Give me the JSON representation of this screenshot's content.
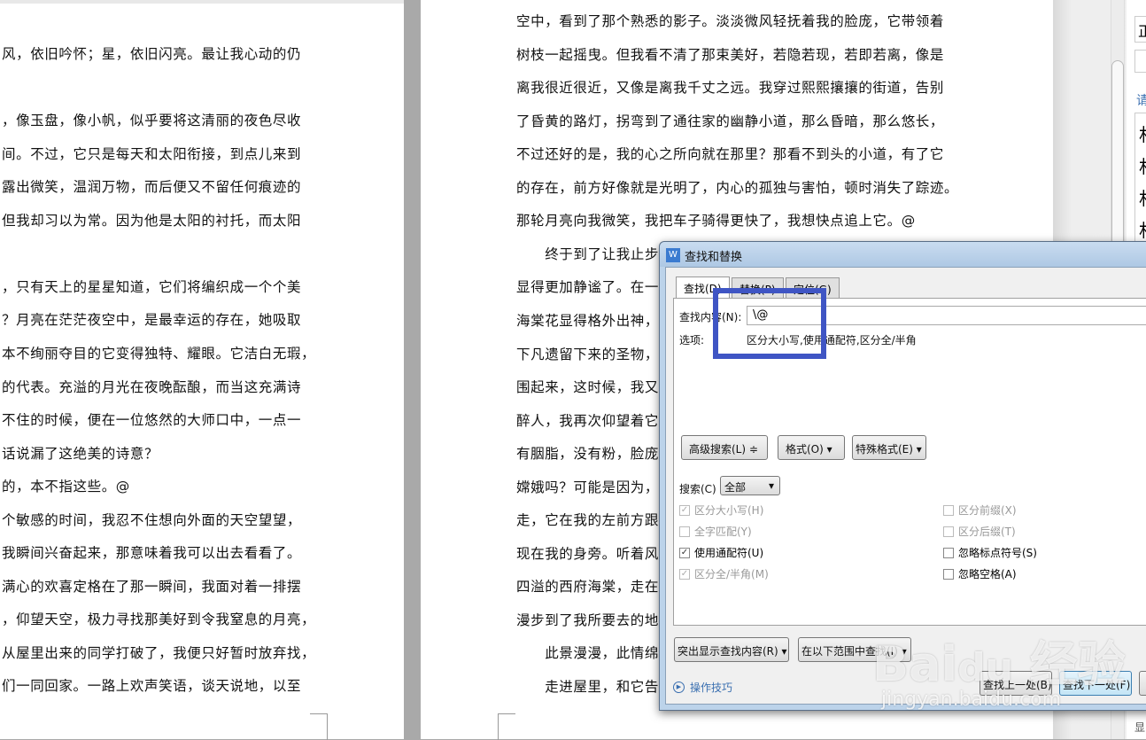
{
  "document": {
    "left_page_lines": [
      "风，依旧吟怀；星，依旧闪亮。最让我心动的仍",
      "",
      "，像玉盘，像小帆，似乎要将这清丽的夜色尽收",
      "间。不过，它只是每天和太阳衔接，到点儿来到",
      "露出微笑，温润万物，而后便又不留任何痕迹的",
      "但我却习以为常。因为他是太阳的衬托，而太阳",
      "",
      "，只有天上的星星知道，它们将编织成一个个美",
      "？月亮在茫茫夜空中，是最幸运的存在，她吸取",
      "本不绚丽夺目的它变得独特、耀眼。它洁白无瑕，",
      "的代表。充溢的月光在夜晚酝酿，而当这充满诗",
      "不住的时候，便在一位悠然的大师口中，一点一",
      "话说漏了这绝美的诗意？",
      "的，本不指这些。@",
      "个敏感的时间，我忍不住想向外面的天空望望，",
      "我瞬间兴奋起来，那意味着我可以出去看看了。",
      "满心的欢喜定格在了那一瞬间，我面对着一排摆",
      "，仰望天空，极力寻找那美好到令我窒息的月亮，",
      "从屋里出来的同学打破了，我便只好暂时放弃找，",
      "们一同回家。一路上欢声笑语，谈天说地，以至"
    ],
    "right_page_lines": [
      "空中，看到了那个熟悉的影子。淡淡微风轻抚着我的脸庞，它带领着",
      "树枝一起摇曳。但我看不清了那束美好，若隐若现，若即若离，像是",
      "离我很近很近，又像是离我千丈之远。我穿过熙熙攘攘的街道，告别",
      "了昏黄的路灯，拐弯到了通往家的幽静小道，那么昏暗，那么悠长，",
      "不过还好的是，我的心之所向就在那里？那看不到头的小道，有了它",
      "的存在，前方好像就是光明了，内心的孤独与害怕，顿时消失了踪迹。",
      "那轮月亮向我微笑，我把车子骑得更快了，我想快点追上它。@",
      "　　终于到了让我止步",
      "显得更加静谧了。在一",
      "海棠花显得格外出神，",
      "下凡遗留下来的圣物，",
      "围起来，这时候，我又",
      "醉人，我再次仰望着它",
      "有胭脂，没有粉，脸庞",
      "嫦娥吗？可能是因为，",
      "走，它在我的左前方跟",
      "现在我的身旁。听着风",
      "四溢的西府海棠，走在",
      "漫步到了我所要去的地",
      "　　此景漫漫，此情绵",
      "　　走进屋里，和它告"
    ]
  },
  "side_panel": {
    "items": [
      "正",
      "",
      "请",
      "村",
      "村",
      "村",
      "村"
    ],
    "bottom_label": "显"
  },
  "dialog": {
    "app_icon": "W",
    "title": "查找和替换",
    "tabs": [
      {
        "label": "查找(D)",
        "active": true
      },
      {
        "label": "替换(P)",
        "active": false
      },
      {
        "label": "定位(G)",
        "active": false
      }
    ],
    "find_label": "查找内容(N):",
    "find_value": "\\@",
    "options_label": "选项:",
    "options_value": "区分大小写,使用通配符,区分全/半角",
    "advanced_button": "高级搜索(L) ≑",
    "format_button": "格式(O) ▾",
    "special_button": "特殊格式(E) ▾",
    "search_label": "搜索(C)",
    "search_value": "全部",
    "checkboxes_left": [
      {
        "label": "区分大小写(H)",
        "checked": true,
        "disabled": true
      },
      {
        "label": "全字匹配(Y)",
        "checked": false,
        "disabled": true
      },
      {
        "label": "使用通配符(U)",
        "checked": true,
        "disabled": false
      },
      {
        "label": "区分全/半角(M)",
        "checked": true,
        "disabled": true
      }
    ],
    "checkboxes_right": [
      {
        "label": "区分前缀(X)",
        "checked": false,
        "disabled": true
      },
      {
        "label": "区分后缀(T)",
        "checked": false,
        "disabled": true
      },
      {
        "label": "忽略标点符号(S)",
        "checked": false,
        "disabled": false
      },
      {
        "label": "忽略空格(A)",
        "checked": false,
        "disabled": false
      }
    ],
    "highlight_button": "突出显示查找内容(R) ▾",
    "find_in_button": "在以下范围中查找(I) ▾",
    "tips_link": "操作技巧",
    "find_prev_button": "查找上一处(B)",
    "find_next_button": "查找下一处(F)"
  },
  "annotation": {
    "color": "#3f55c4"
  },
  "watermark": {
    "text": "Bai du 经验",
    "url_text": "jingyan.baidu.com"
  }
}
